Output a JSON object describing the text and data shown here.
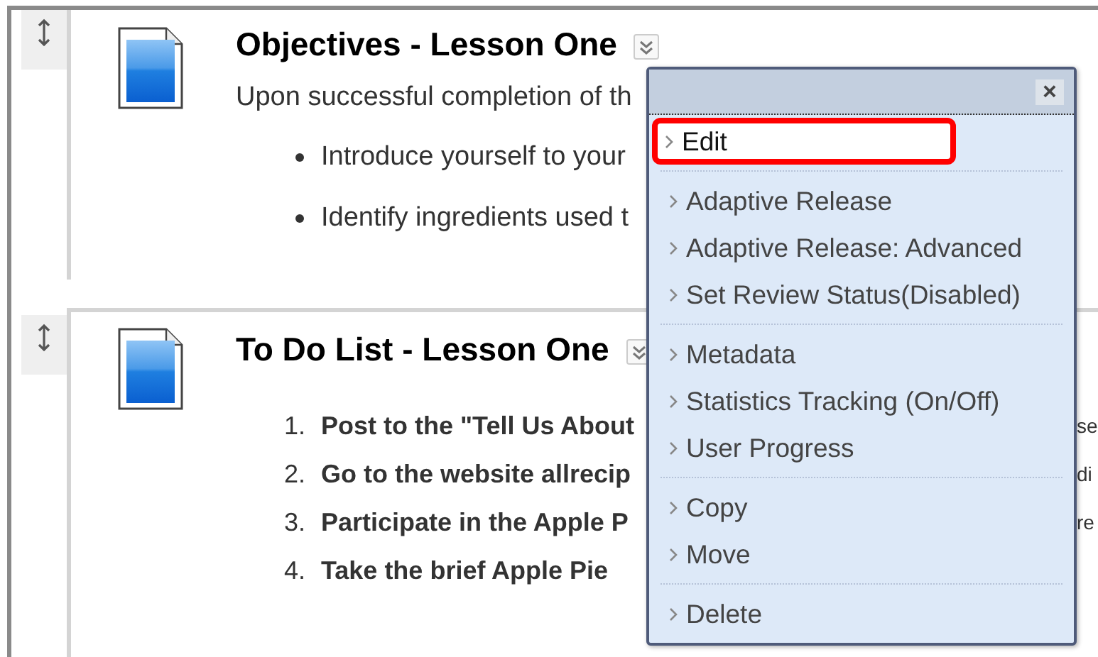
{
  "panels": [
    {
      "title": "Objectives - Lesson One",
      "intro": "Upon successful completion of th",
      "items": [
        {
          "kind": "bullet",
          "text": "Introduce yourself to your"
        },
        {
          "kind": "bullet",
          "text": "Identify ingredients used t"
        }
      ]
    },
    {
      "title": "To Do List - Lesson One",
      "items": [
        {
          "kind": "numbered",
          "number": "1.",
          "text": "Post to the \"Tell Us About",
          "tail": "se"
        },
        {
          "kind": "numbered",
          "number": "2.",
          "text": "Go to the website allrecip",
          "tail": "di"
        },
        {
          "kind": "numbered",
          "number": "3.",
          "text": "Participate in the Apple P",
          "tail": "re"
        },
        {
          "kind": "numbered",
          "number": "4.",
          "text": "Take the brief Apple Pie"
        }
      ]
    }
  ],
  "menu": {
    "close": "×",
    "groups": [
      [
        {
          "label": "Edit",
          "selected": true
        }
      ],
      [
        {
          "label": "Adaptive Release",
          "selected": false
        },
        {
          "label": "Adaptive Release: Advanced",
          "selected": false
        },
        {
          "label": "Set Review Status(Disabled)",
          "selected": false
        }
      ],
      [
        {
          "label": "Metadata",
          "selected": false
        },
        {
          "label": "Statistics Tracking (On/Off)",
          "selected": false
        },
        {
          "label": "User Progress",
          "selected": false
        }
      ],
      [
        {
          "label": "Copy",
          "selected": false
        },
        {
          "label": "Move",
          "selected": false
        }
      ],
      [
        {
          "label": "Delete",
          "selected": false
        }
      ]
    ]
  }
}
